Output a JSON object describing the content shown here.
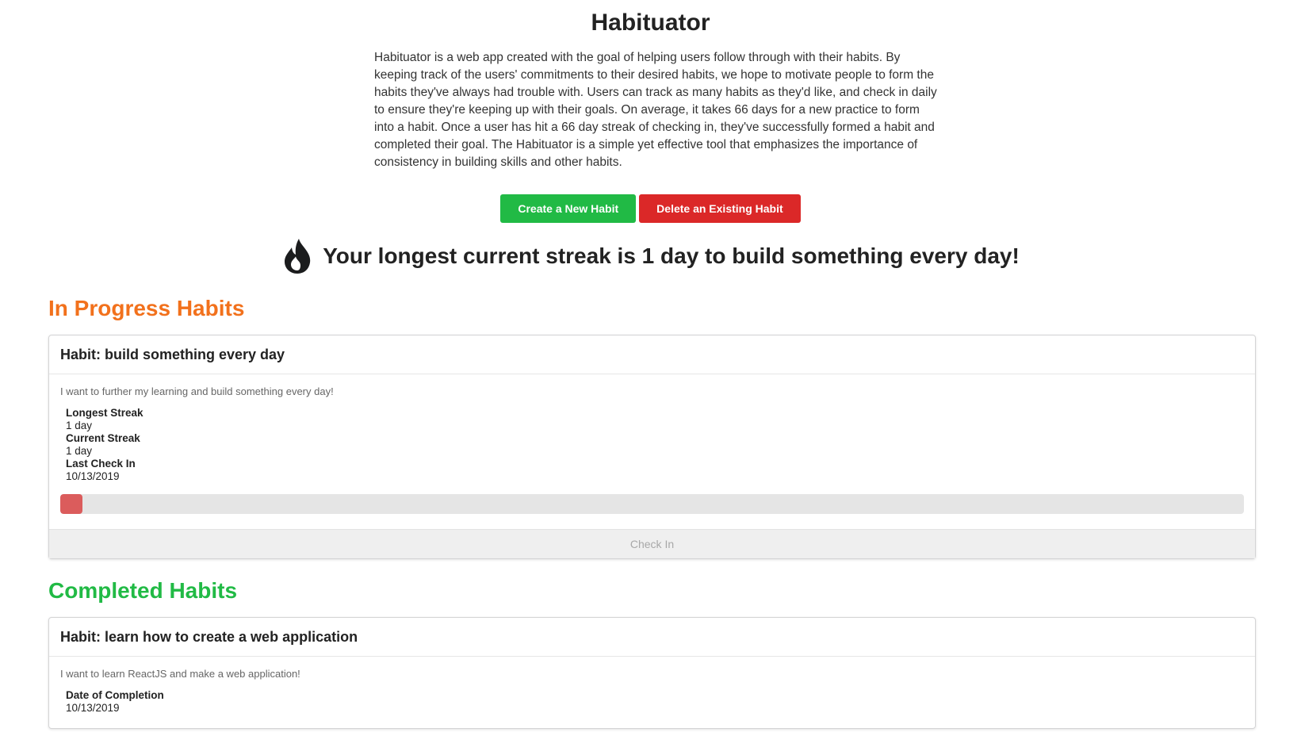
{
  "app": {
    "title": "Habituator",
    "description": "Habituator is a web app created with the goal of helping users follow through with their habits. By keeping track of the users' commitments to their desired habits, we hope to motivate people to form the habits they've always had trouble with. Users can track as many habits as they'd like, and check in daily to ensure they're keeping up with their goals. On average, it takes 66 days for a new practice to form into a habit. Once a user has hit a 66 day streak of checking in, they've successfully formed a habit and completed their goal. The Habituator is a simple yet effective tool that emphasizes the importance of consistency in building skills and other habits."
  },
  "actions": {
    "create_label": "Create a New Habit",
    "delete_label": "Delete an Existing Habit"
  },
  "streak": {
    "icon": "flame-icon",
    "text": "Your longest current streak is 1 day to build something every day!"
  },
  "in_progress": {
    "heading": "In Progress Habits",
    "habit": {
      "title": "Habit: build something every day",
      "description": "I want to further my learning and build something every day!",
      "longest_streak_label": "Longest Streak",
      "longest_streak_value": "1 day",
      "current_streak_label": "Current Streak",
      "current_streak_value": "1 day",
      "last_checkin_label": "Last Check In",
      "last_checkin_value": "10/13/2019",
      "progress_fraction": 0.015,
      "check_in_label": "Check In"
    }
  },
  "completed": {
    "heading": "Completed Habits",
    "habit": {
      "title": "Habit: learn how to create a web application",
      "description": "I want to learn ReactJS and make a web application!",
      "completion_label": "Date of Completion",
      "completion_value": "10/13/2019"
    }
  },
  "colors": {
    "in_progress_heading": "#f2711c",
    "completed_heading": "#21ba45",
    "create_button": "#21ba45",
    "delete_button": "#db2828",
    "progress_fill": "#db5c5c"
  }
}
